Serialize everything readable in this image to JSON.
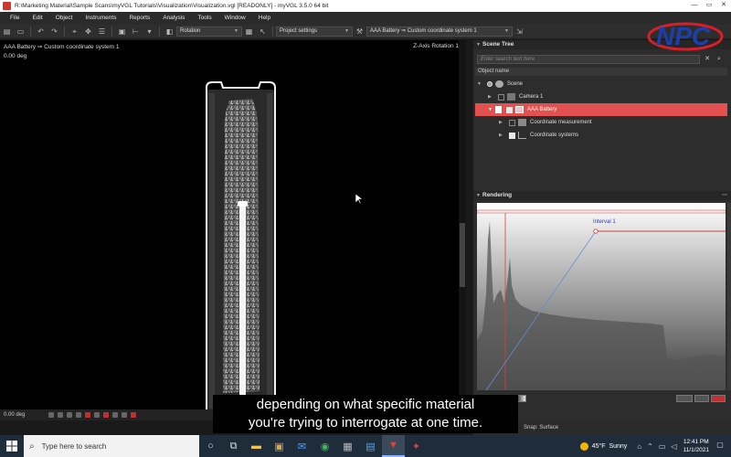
{
  "window": {
    "title": "R:\\Marketing Material\\Sample Scans\\myVGL Tutorials\\Visualization\\Visualization.vgl [READONLY] - myVGL 3.5.0 64 bit",
    "controls": {
      "minimize": "—",
      "restore": "▭",
      "close": "✕"
    }
  },
  "menu": [
    "File",
    "Edit",
    "Object",
    "Instruments",
    "Reports",
    "Analysis",
    "Tools",
    "Window",
    "Help"
  ],
  "toolbar": {
    "mode_dropdown": "Rotation",
    "project_settings": "Project settings",
    "coordinate_dropdown": "AAA Battery ⇒ Custom coordinate system 1"
  },
  "viewport": {
    "breadcrumb": "AAA Battery ⇒ Custom coordinate system 1",
    "rotation_readout": "0.00 deg",
    "axis_label": "Z-Axis Rotation 1",
    "bottom_readout": "0.00 deg"
  },
  "scene_tree": {
    "header": "Scene Tree",
    "search_placeholder": "Enter search text here",
    "column_header": "Object name",
    "items": [
      {
        "label": "Scene",
        "icon": "globe-icon"
      },
      {
        "label": "Camera 1",
        "icon": "camera-icon"
      },
      {
        "label": "AAA Battery",
        "icon": "volume-icon",
        "selected": true
      },
      {
        "label": "Coordinate measurement",
        "icon": "measurement-icon"
      },
      {
        "label": "Coordinate systems",
        "icon": "axes-icon"
      }
    ]
  },
  "rendering": {
    "header": "Rendering",
    "interval_label": "Interval 1"
  },
  "status": {
    "snap": "Snap: Surface"
  },
  "caption": {
    "line1": "depending on what specific material",
    "line2": "you're trying to interrogate at one time."
  },
  "taskbar": {
    "search_placeholder": "Type here to search",
    "weather": {
      "temp": "45°F",
      "condition": "Sunny"
    },
    "time": "12:41 PM",
    "date": "11/1/2021"
  },
  "colors": {
    "selection": "#e35050",
    "accent_red": "#d0342c",
    "logo_blue": "#1c3fae",
    "logo_red": "#d81e26"
  }
}
